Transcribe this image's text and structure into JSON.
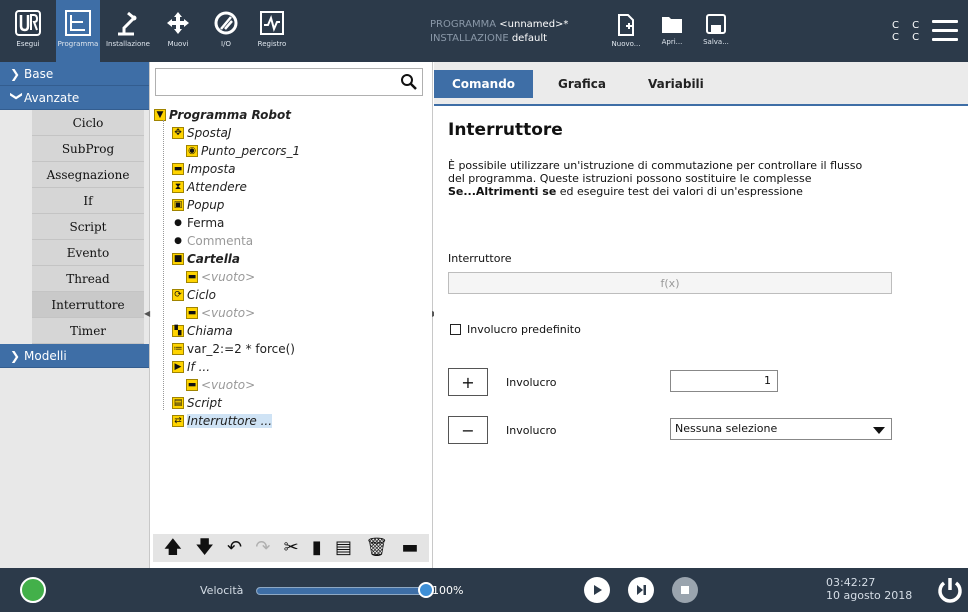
{
  "topbar": {
    "buttons": [
      {
        "id": "run",
        "label": "Esegui",
        "icon": "ur-logo-icon"
      },
      {
        "id": "program",
        "label": "Programma",
        "icon": "program-tree-icon",
        "active": true
      },
      {
        "id": "install",
        "label": "Installazione",
        "icon": "robot-arm-icon"
      },
      {
        "id": "move",
        "label": "Muovi",
        "icon": "move-cross-icon"
      },
      {
        "id": "io",
        "label": "I/O",
        "icon": "io-icon"
      },
      {
        "id": "log",
        "label": "Registro",
        "icon": "log-graph-icon"
      }
    ],
    "program_key": "PROGRAMMA",
    "program_val": "<unnamed>*",
    "install_key": "INSTALLAZIONE",
    "install_val": "default",
    "file_buttons": [
      {
        "label": "Nuovo...",
        "icon": "new-file-icon"
      },
      {
        "label": "Apri...",
        "icon": "folder-icon"
      },
      {
        "label": "Salva...",
        "icon": "save-icon"
      }
    ],
    "cc_line1": "C C",
    "cc_line2": "C C"
  },
  "sidebar": {
    "categories": [
      {
        "label": "Base",
        "expanded": false
      },
      {
        "label": "Avanzate",
        "expanded": true
      },
      {
        "label": "Modelli",
        "expanded": false
      }
    ],
    "advanced_items": [
      "Ciclo",
      "SubProg",
      "Assegnazione",
      "If",
      "Script",
      "Evento",
      "Thread",
      "Interruttore",
      "Timer"
    ]
  },
  "tree": {
    "search_placeholder": "",
    "nodes": [
      {
        "text": "Programma Robot",
        "style": "bold-ital",
        "icon": "▼",
        "indent": 0
      },
      {
        "text": "SpostaJ",
        "style": "ital",
        "icon": "✥",
        "indent": 1
      },
      {
        "text": "Punto_percors_1",
        "style": "ital",
        "icon": "◉",
        "indent": 2
      },
      {
        "text": "Imposta",
        "style": "ital",
        "icon": "▬",
        "indent": 1
      },
      {
        "text": "Attendere",
        "style": "ital",
        "icon": "⧗",
        "indent": 1
      },
      {
        "text": "Popup",
        "style": "ital",
        "icon": "▣",
        "indent": 1
      },
      {
        "text": "Ferma",
        "style": "normal",
        "icon": "●",
        "indent": 1
      },
      {
        "text": "Commenta",
        "style": "grey-normal",
        "icon": "●",
        "indent": 1
      },
      {
        "text": "Cartella",
        "style": "bold-ital",
        "icon": "■",
        "indent": 1
      },
      {
        "text": "<vuoto>",
        "style": "grey",
        "icon": "▬",
        "indent": 2
      },
      {
        "text": "Ciclo",
        "style": "ital",
        "icon": "⟳",
        "indent": 1
      },
      {
        "text": "<vuoto>",
        "style": "grey",
        "icon": "▬",
        "indent": 2
      },
      {
        "text": "Chiama",
        "style": "ital",
        "icon": "▚",
        "indent": 1
      },
      {
        "text": "var_2:=2 * force()",
        "style": "normal",
        "icon": "≔",
        "indent": 1
      },
      {
        "text": "If ...",
        "style": "ital",
        "icon": "▶",
        "indent": 1
      },
      {
        "text": "<vuoto>",
        "style": "grey",
        "icon": "▬",
        "indent": 2
      },
      {
        "text": "Script",
        "style": "ital",
        "icon": "▤",
        "indent": 1
      },
      {
        "text": "Interruttore ...",
        "style": "ital-sel",
        "icon": "⇄",
        "indent": 1
      }
    ],
    "toolbar": [
      {
        "name": "move-up-icon",
        "glyph": "🡅",
        "enabled": true
      },
      {
        "name": "move-down-icon",
        "glyph": "🡇",
        "enabled": true
      },
      {
        "name": "undo-icon",
        "glyph": "↶",
        "enabled": true
      },
      {
        "name": "redo-icon",
        "glyph": "↷",
        "enabled": false
      },
      {
        "name": "cut-icon",
        "glyph": "✂",
        "enabled": true
      },
      {
        "name": "copy-icon",
        "glyph": "▮",
        "enabled": true
      },
      {
        "name": "paste-icon",
        "glyph": "▤",
        "enabled": true
      },
      {
        "name": "delete-icon",
        "glyph": "🗑",
        "enabled": true
      },
      {
        "name": "suppress-icon",
        "glyph": "▬",
        "enabled": true
      }
    ]
  },
  "tabs": [
    {
      "label": "Comando",
      "active": true
    },
    {
      "label": "Grafica",
      "active": false
    },
    {
      "label": "Variabili",
      "active": false
    }
  ],
  "command": {
    "title": "Interruttore",
    "desc_line1": "È possibile utilizzare un'istruzione di commutazione per controllare il flusso",
    "desc_line2": "del programma. Queste istruzioni possono sostituire le complesse",
    "desc_bold": "Se...Altrimenti se",
    "desc_line3_rest": " ed eseguire test dei valori di un'espressione",
    "switch_label": "Interruttore",
    "expr_placeholder": "f(x)",
    "default_case_label": "Involucro predefinito",
    "add_case_label": "Involucro",
    "remove_case_label": "Involucro",
    "case_value": "1",
    "case_select_value": "Nessuna selezione"
  },
  "bottombar": {
    "speed_label": "Velocità",
    "speed_value": "100%",
    "speed_fraction": 1.0,
    "time": "03:42:27",
    "date": "10 agosto 2018",
    "accent": "#3e6ea6",
    "status_color": "#43b04a"
  }
}
